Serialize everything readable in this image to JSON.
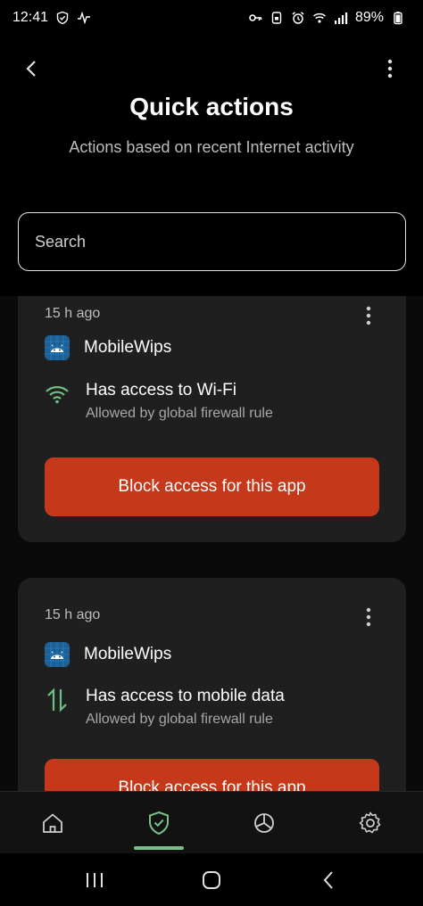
{
  "status_bar": {
    "time": "12:41",
    "battery": "89%"
  },
  "header": {
    "title": "Quick actions",
    "subtitle": "Actions based on recent Internet activity"
  },
  "search": {
    "placeholder": "Search"
  },
  "cards": [
    {
      "time": "15 h ago",
      "app_name": "MobileWips",
      "permission_title": "Has access to Wi-Fi",
      "permission_sub": "Allowed by global firewall rule",
      "button_label": "Block access for this app"
    },
    {
      "time": "15 h ago",
      "app_name": "MobileWips",
      "permission_title": "Has access to mobile data",
      "permission_sub": "Allowed by global firewall rule",
      "button_label": "Block access for this app"
    }
  ],
  "colors": {
    "accent_green": "#78c08a",
    "block_button": "#c5391a",
    "card_bg": "#1f1f1f"
  },
  "bottom_nav": {
    "items": [
      "home-icon",
      "shield-check-icon",
      "pie-chart-icon",
      "gear-icon"
    ],
    "selected": "shield-check-icon"
  }
}
